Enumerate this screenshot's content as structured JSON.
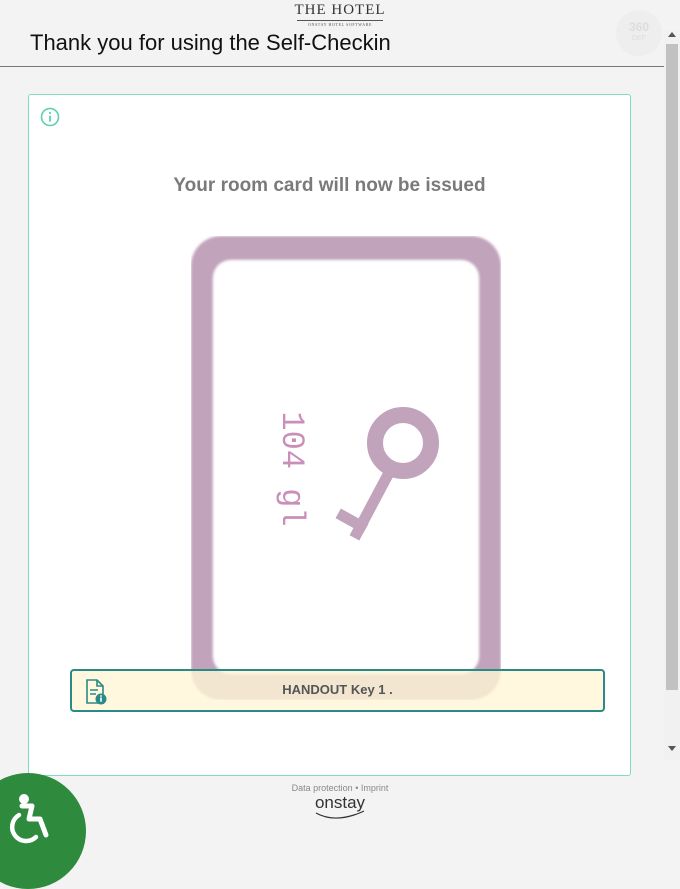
{
  "header": {
    "logo_title": "THE HOTEL",
    "logo_subtitle": "ONSTAY HOTEL SOFTWARE",
    "page_title": "Thank you for using the Self-Checkin",
    "badge_main": "360",
    "badge_sub": "DEF"
  },
  "panel": {
    "message": "Your room card will now be issued",
    "card_room_label": "104 gl",
    "handout_text": "HANDOUT Key 1 ."
  },
  "footer": {
    "data_protection": "Data protection",
    "separator": " • ",
    "imprint": "Imprint",
    "brand": "onstay"
  },
  "icons": {
    "info": "info-circle-icon",
    "handout": "document-info-icon",
    "key": "key-icon",
    "accessibility": "wheelchair-icon"
  },
  "colors": {
    "accent_border": "#7fdcc0",
    "card_frame": "#c1a3bc",
    "handout_border": "#2a8a88",
    "handout_bg": "#fff6d6",
    "accessibility_bg": "#2e8b3e"
  }
}
